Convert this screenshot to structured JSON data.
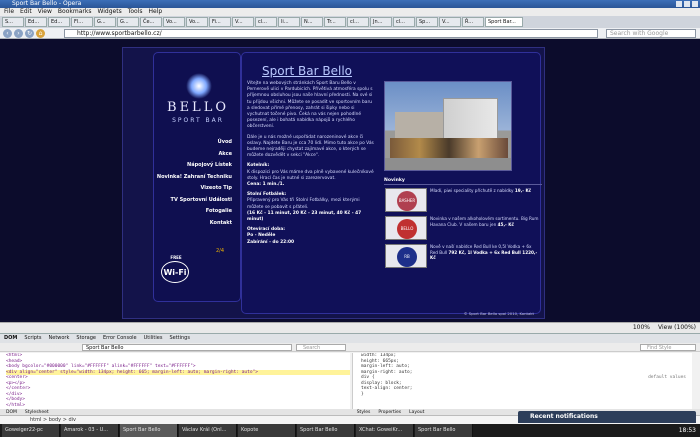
{
  "window": {
    "title": "Sport Bar Bello - Opera"
  },
  "menu": [
    "File",
    "Edit",
    "View",
    "Bookmarks",
    "Widgets",
    "Tools",
    "Help"
  ],
  "tabs": [
    "S...",
    "Ed...",
    "Ed...",
    "Fl...",
    "G...",
    "G...",
    "Če...",
    "Vo...",
    "Vo...",
    "Fi...",
    "V...",
    "cl...",
    "li...",
    "N...",
    "Tr...",
    "cl...",
    "Jn...",
    "cl...",
    "Sp...",
    "V...",
    "Ř...",
    "Sport Bar..."
  ],
  "nav": {
    "url": "http://www.sportbarbello.cz/",
    "search_placeholder": "Search with Google"
  },
  "site": {
    "logo_line1": "BELLO",
    "logo_line2": "SPORT BAR",
    "menu": [
      "Úvod",
      "Akce",
      "Nápojový Lístek",
      "Novinka! Zahraní Techniku",
      "Vizeoto Tip",
      "TV Sportovní Události",
      "Fotogalie",
      "Kontakt"
    ],
    "tag": "2/4",
    "wifi": {
      "top": "FREE",
      "label": "Wi-Fi",
      "bottom": "SPOT"
    },
    "title": "Sport Bar Bello",
    "intro": "Vítejte na webových stránkách Sport Baru Bello v Pernerově ulici v Pardubicích. Přívětivá atmosféra spolu s příjemnou obsluhou jsou naše hlavní přednosti. Na své si tu přijdou všichni. Můžete se posadit ve sportovním baru a sledovat přímé přenosy, zahrát si šipky nebo si vychutnat točené pivo. Čeká na vás nejen pohodlné posezení, ale i bohatá nabídka nápojů a rychlého občerstvení.",
    "intro2": "Dále je u nás možné uspořádat narozeninové akce či oslavy. Najdete Baru je cca 70 lidí. Mimo tuto akce po Vás budeme nejraději chystat zajímavé akce, o kterých se můžete dozvědět v sekci \"Akce\".",
    "kotel_head": "Kotelník:",
    "kotel_text": "K dispozici pro Vás máme dva plně vybavené kulečníkové stoly. Hrací čas je nutné si zarezervovat.",
    "kotel_price": "Cena: 1 min./1.",
    "sport_head": "Stolní Fotbálek:",
    "sport_text": "Připravený pro Vás tři Stolní Fotbálky, mezi kterými můžete se pobavit s přáteli.",
    "sport_times": "(16 Kč - 11 minut, 20 Kč - 23 minut, 40 Kč - 47 minut)",
    "hours_head": "Otevírací doba:",
    "hours_1": "Po - Neděle",
    "hours_2": "Zabírání - do 22:00",
    "news_head": "Novinky",
    "news": [
      {
        "img": "BASHER",
        "text": "Mladí, piwi speciality příchutě z nabídky",
        "bold": "19,- Kč"
      },
      {
        "img": "BELLO",
        "text": "Novinka v našem alkoholovém sortimentu. Big Rum Havana Club. V našem baru jen",
        "bold": "45,- Kč"
      },
      {
        "img": "RB",
        "text": "Nově v naší nabídce Red Bull ke 0,5l Vodka + 6x Red Bull",
        "bold": "792 Kč, 1l Vodka + 6x Red Bull 1220,- Kč"
      }
    ],
    "footer": "© Sport Bar Bello spol 2010, Kontakt"
  },
  "status": {
    "zoom": "100%",
    "view": "View (100%)"
  },
  "devtools": {
    "tabs": [
      "DOM",
      "Scripts",
      "Network",
      "Storage",
      "Error Console",
      "Utilities",
      "Settings"
    ],
    "document": "Sport Bar Bello",
    "search": "Search",
    "find": "Find Style",
    "dom_lines": [
      "<html>",
      " <head>",
      "  <body bgcolor=\"#000000\" link=\"#FFFFFF\" alink=\"#FFFFFF\" text=\"#FFFFFF\">",
      "   <div align=\"center\" style=\"width: 134px; height: 665; margin-left: auto; margin-right: auto\">",
      "    <center>",
      "     <p></p>",
      "    </center>",
      "   </div>",
      "  </body>",
      " </html>"
    ],
    "css_lines": [
      "width: 134px;",
      "height: 665px;",
      "margin-left: auto;",
      "margin-right: auto;",
      "",
      "div {",
      "  display: block;",
      "  text-align: center;",
      "}"
    ],
    "css_default": "default values",
    "bottom_tabs": [
      "DOM",
      "Stylesheet"
    ],
    "css_tabs": [
      "Styles",
      "Properties",
      "Layout"
    ],
    "crumbs": "html > body > div"
  },
  "notification": "Recent notifications",
  "taskbar": [
    "Goweiger22-pc",
    "Amarok - 03 - U...",
    "Sport Bar Bello",
    "Václav Král (Onl...",
    "Kopote",
    "Sport Bar Bello",
    "XChat: GoweiKr...",
    "Sport Bar Bello"
  ],
  "clock": "18:53"
}
